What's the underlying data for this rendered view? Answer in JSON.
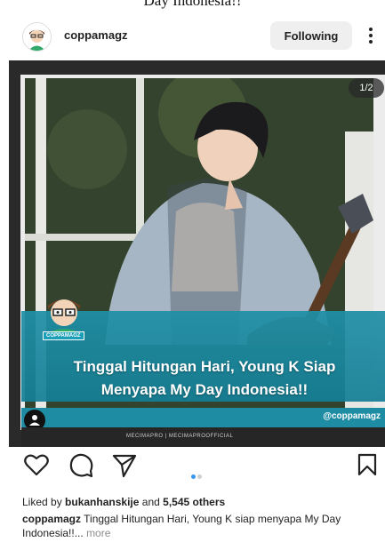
{
  "top_caption": "Day Indonesia!!",
  "header": {
    "username": "coppamagz",
    "follow_label": "Following"
  },
  "post": {
    "counter": "1/2",
    "headline_line1": "Tinggal Hitungan Hari, Young K Siap",
    "headline_line2": "Menyapa My Day Indonesia!!",
    "logo_text": "COPPAMAGZ",
    "handle": "@coppamagz",
    "social_text": "MECIMAPRO | MECIMAPROOFFICIAL",
    "carousel": {
      "current": 1,
      "total": 2
    }
  },
  "likes": {
    "prefix": "Liked by",
    "user": "bukanhanskije",
    "middle": "and",
    "count": "5,545 others"
  },
  "caption": {
    "username": "coppamagz",
    "text": "Tinggal Hitungan Hari, Young K siap menyapa My Day Indonesia!!...",
    "more": "more"
  },
  "colors": {
    "accent_blue": "#3897f0",
    "banner_teal": "#1a8ca3"
  },
  "icons": [
    "heart-icon",
    "comment-icon",
    "share-icon",
    "bookmark-icon",
    "more-icon"
  ]
}
